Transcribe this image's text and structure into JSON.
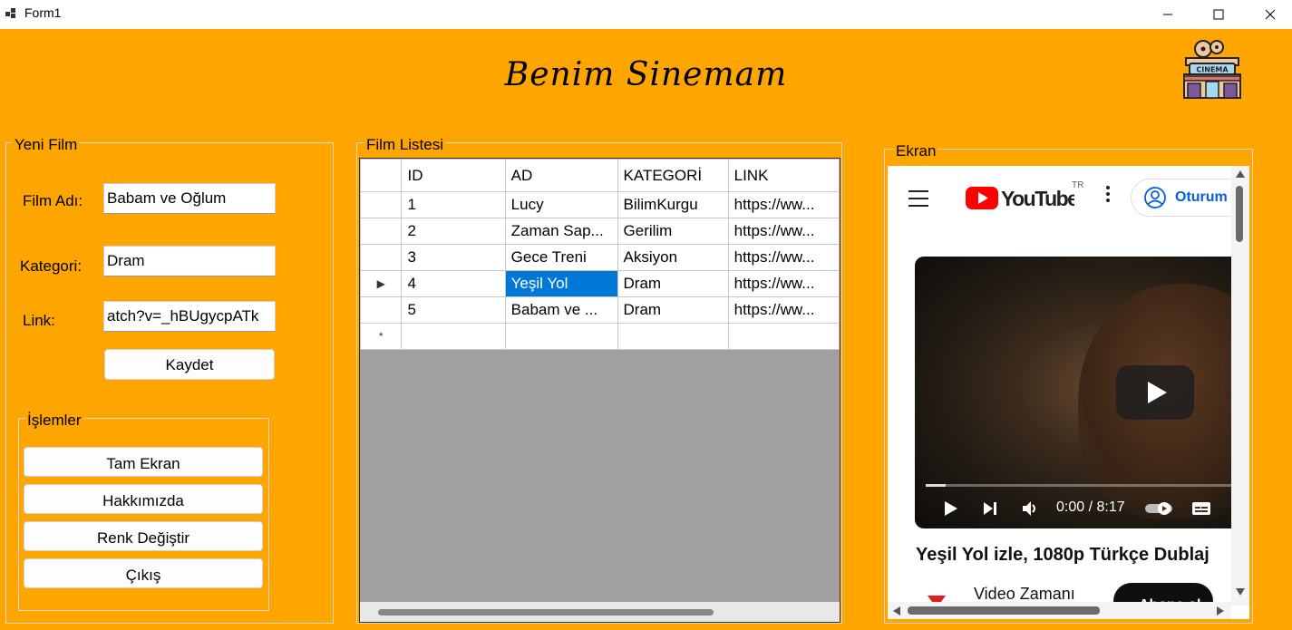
{
  "window": {
    "title": "Form1"
  },
  "header": {
    "title": "Benim Sinemam",
    "logo_text": "CINEMA"
  },
  "new_film": {
    "group_label": "Yeni Film",
    "name_label": "Film Adı:",
    "name_value": "Babam ve Oğlum",
    "category_label": "Kategori:",
    "category_value": "Dram",
    "link_label": "Link:",
    "link_value": "atch?v=_hBUgycpATk",
    "save_label": "Kaydet"
  },
  "actions": {
    "group_label": "İşlemler",
    "fullscreen_label": "Tam Ekran",
    "about_label": "Hakkımızda",
    "color_label": "Renk Değiştir",
    "exit_label": "Çıkış"
  },
  "film_list": {
    "group_label": "Film Listesi",
    "columns": [
      "ID",
      "AD",
      "KATEGORİ",
      "LINK"
    ],
    "rows": [
      {
        "id": "1",
        "name": "Lucy",
        "category": "BilimKurgu",
        "link": "https://ww..."
      },
      {
        "id": "2",
        "name": "Zaman Sap...",
        "category": "Gerilim",
        "link": "https://ww..."
      },
      {
        "id": "3",
        "name": "Gece Treni",
        "category": "Aksiyon",
        "link": "https://ww..."
      },
      {
        "id": "4",
        "name": "Yeşil Yol",
        "category": "Dram",
        "link": "https://ww..."
      },
      {
        "id": "5",
        "name": "Babam ve ...",
        "category": "Dram",
        "link": "https://ww..."
      }
    ],
    "current_row_marker": "▶",
    "new_row_marker": "*"
  },
  "screen": {
    "group_label": "Ekran",
    "youtube": {
      "logo_text": "YouTube",
      "region": "TR",
      "signin_label": "Oturum",
      "video_time": "0:00 / 8:17",
      "video_title": "Yeşil Yol izle, 1080p Türkçe Dublaj",
      "channel_name": "Video Zamanı",
      "subscribe_label": "Abone ol"
    }
  },
  "colors": {
    "background": "#FFA500",
    "selection": "#0078d7",
    "youtube_red": "#FF0000",
    "link_blue": "#065fd4"
  }
}
